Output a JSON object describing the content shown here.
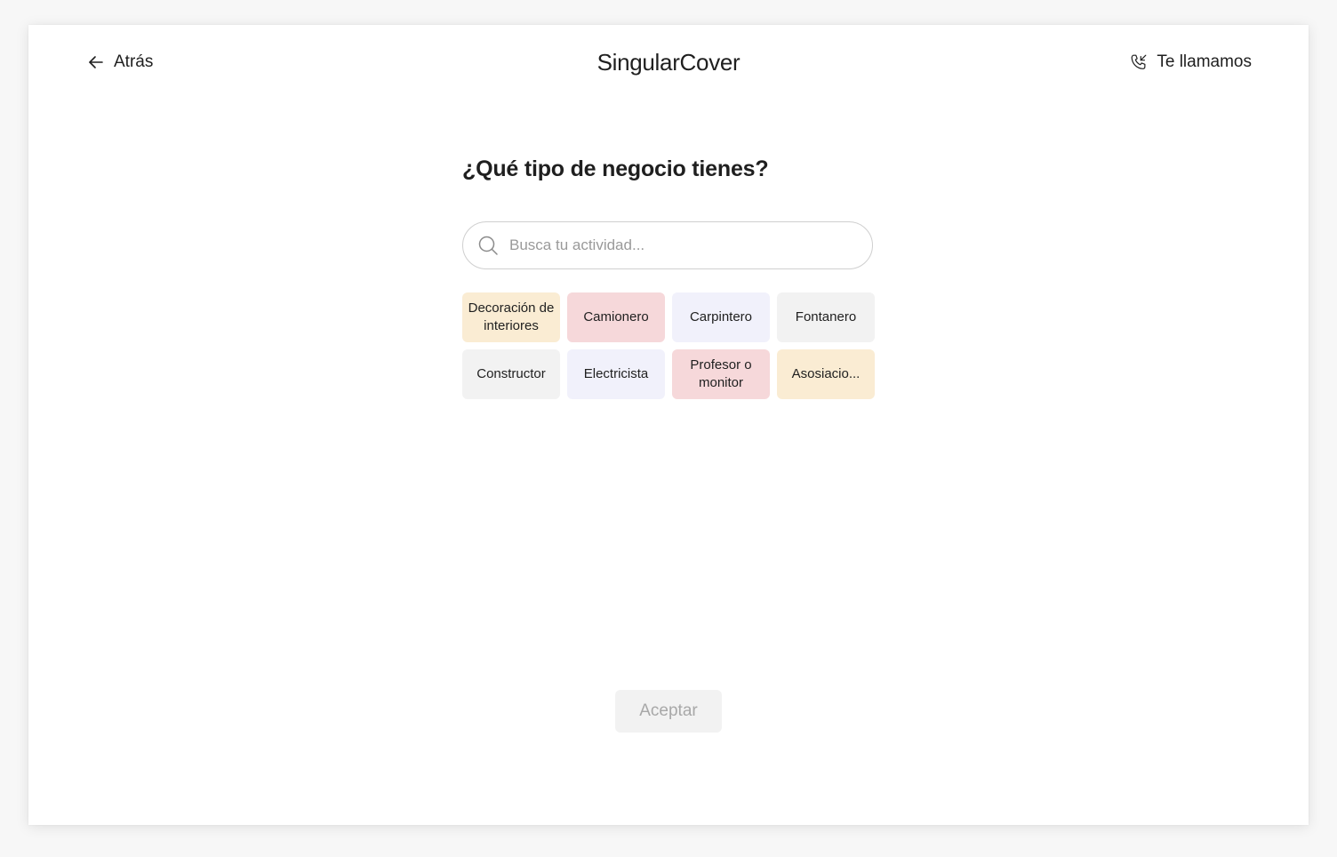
{
  "header": {
    "back_label": "Atrás",
    "brand": "SingularCover",
    "call_label": "Te llamamos"
  },
  "main": {
    "question": "¿Qué tipo de negocio tienes?",
    "search": {
      "placeholder": "Busca tu actividad...",
      "value": ""
    },
    "activities": [
      {
        "label": "Decoración de interiores",
        "color": "#faecd3"
      },
      {
        "label": "Camionero",
        "color": "#f6d8da"
      },
      {
        "label": "Carpintero",
        "color": "#f1f1fb"
      },
      {
        "label": "Fontanero",
        "color": "#f2f2f2"
      },
      {
        "label": "Constructor",
        "color": "#f2f2f2"
      },
      {
        "label": "Electricista",
        "color": "#f1f1fb"
      },
      {
        "label": "Profesor o monitor",
        "color": "#f6d8da"
      },
      {
        "label": "Asosiacio...",
        "color": "#faecd3"
      }
    ],
    "accept_label": "Aceptar"
  },
  "icons": {
    "back": "arrow-left-icon",
    "call": "phone-incoming-icon",
    "search": "search-icon"
  }
}
